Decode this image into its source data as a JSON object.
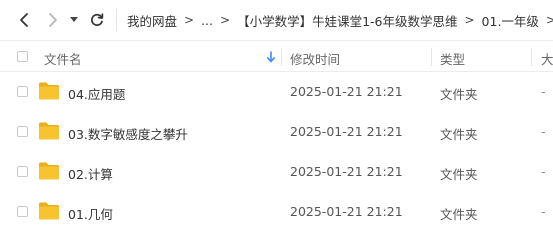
{
  "nav": {
    "back_icon": "chevron-left-icon",
    "forward_icon": "chevron-right-icon",
    "dropdown_icon": "caret-down-icon",
    "refresh_icon": "refresh-icon"
  },
  "breadcrumb": {
    "items": [
      "我的网盘",
      "...",
      "【小学数学】牛娃课堂1-6年级数学思维",
      "01.一年级"
    ],
    "separator": ">"
  },
  "table": {
    "columns": {
      "name": "文件名",
      "modified": "修改时间",
      "type": "类型",
      "size": "大"
    },
    "sort_icon": "sort-down-arrow-icon",
    "rows": [
      {
        "name": "04.应用题",
        "modified": "2025-01-21 21:21",
        "type": "文件夹",
        "size": "-"
      },
      {
        "name": "03.数字敏感度之攀升",
        "modified": "2025-01-21 21:21",
        "type": "文件夹",
        "size": "-"
      },
      {
        "name": "02.计算",
        "modified": "2025-01-21 21:21",
        "type": "文件夹",
        "size": "-"
      },
      {
        "name": "01.几何",
        "modified": "2025-01-21 21:21",
        "type": "文件夹",
        "size": "-"
      }
    ]
  },
  "colors": {
    "folder": "#f7c331",
    "folder_dark": "#eab01c",
    "accent_blue": "#3b8cf7"
  }
}
